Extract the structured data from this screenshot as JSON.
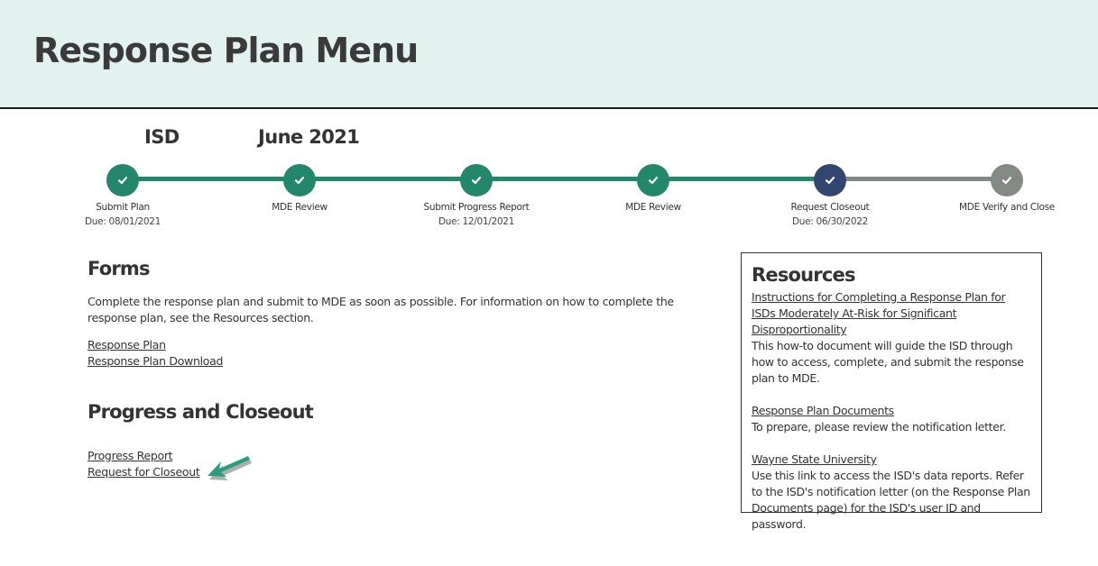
{
  "header": {
    "title": "Response Plan Menu"
  },
  "meta": {
    "organization": "ISD",
    "period": "June 2021"
  },
  "colors": {
    "complete": "#23876b",
    "current": "#33466f",
    "pending": "#838985",
    "header_bg": "#e2f3ef"
  },
  "timeline": {
    "steps": [
      {
        "label": "Submit Plan",
        "due": "Due: 08/01/2021",
        "status": "complete"
      },
      {
        "label": "MDE Review",
        "due": "",
        "status": "complete"
      },
      {
        "label": "Submit Progress Report",
        "due": "Due: 12/01/2021",
        "status": "complete"
      },
      {
        "label": "MDE Review",
        "due": "",
        "status": "complete"
      },
      {
        "label": "Request Closeout",
        "due": "Due: 06/30/2022",
        "status": "current"
      },
      {
        "label": "MDE Verify and Close",
        "due": "",
        "status": "pending"
      }
    ]
  },
  "forms": {
    "title": "Forms",
    "description": "Complete the response plan and submit to MDE as soon as possible. For information on how to complete the response plan, see the Resources section.",
    "links": [
      "Response Plan",
      "Response Plan Download"
    ]
  },
  "progress": {
    "title": "Progress and Closeout",
    "links": [
      "Progress Report",
      "Request for Closeout"
    ]
  },
  "resources": {
    "title": "Resources",
    "items": [
      {
        "link": "Instructions for Completing a Response Plan for ISDs Moderately At-Risk for Significant Disproportionality",
        "text": "This how-to document will guide the ISD through how to access, complete, and submit the response plan to MDE."
      },
      {
        "link": "Response Plan Documents",
        "text": "To prepare, please review the notification letter."
      },
      {
        "link": "Wayne State University",
        "text": "Use this link to access the ISD's data reports. Refer to the ISD's notification letter (on the Response Plan Documents page) for the ISD's user ID and password."
      }
    ]
  }
}
